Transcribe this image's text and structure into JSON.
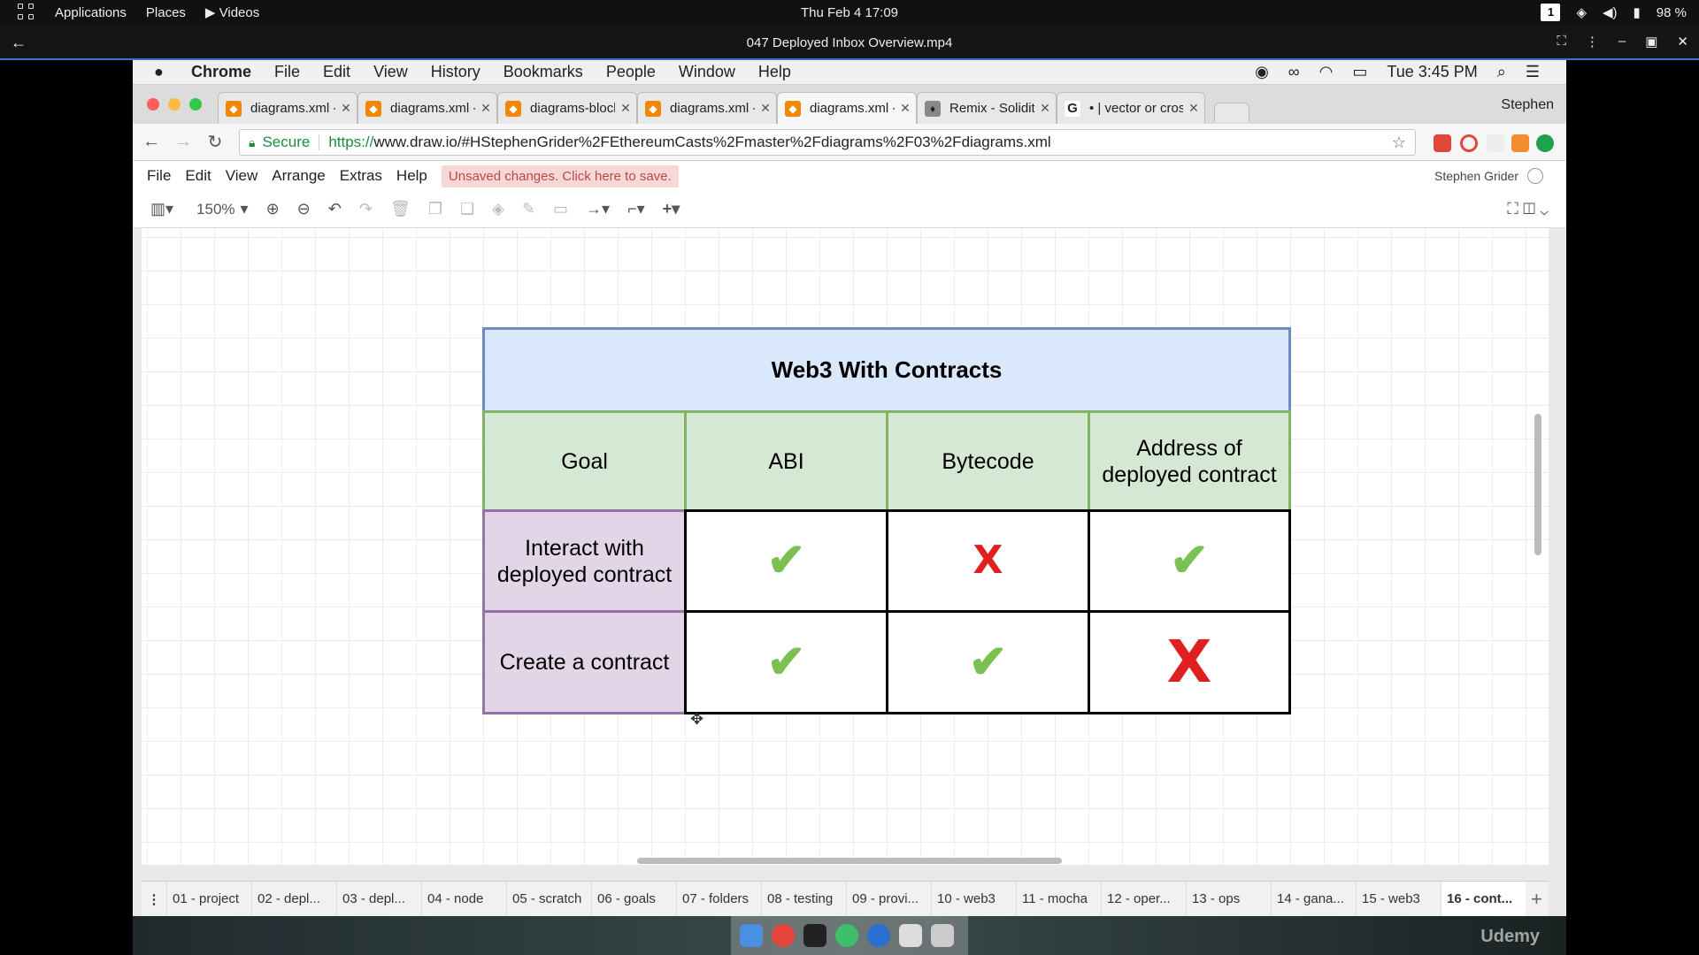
{
  "gnome": {
    "menu_applications": "Applications",
    "menu_places": "Places",
    "menu_videos": "Videos",
    "clock": "Thu Feb 4  17:09",
    "workspace": "1",
    "battery": "98 %"
  },
  "player": {
    "title": "047 Deployed Inbox Overview.mp4"
  },
  "mac": {
    "app": "Chrome",
    "menus": [
      "File",
      "Edit",
      "View",
      "History",
      "Bookmarks",
      "People",
      "Window",
      "Help"
    ],
    "time": "Tue 3:45 PM"
  },
  "chrome": {
    "tabs": [
      {
        "label": "diagrams.xml - dr",
        "color": "#f08705"
      },
      {
        "label": "diagrams.xml - dr",
        "color": "#f08705"
      },
      {
        "label": "diagrams-blockch",
        "color": "#f08705"
      },
      {
        "label": "diagrams.xml - dr",
        "color": "#f08705"
      },
      {
        "label": "diagrams.xml - dr",
        "color": "#f08705"
      },
      {
        "label": "Remix - Solidity ID",
        "color": "#888888"
      },
      {
        "label": "• | vector or cross",
        "color": "#ffffff"
      }
    ],
    "profile": "Stephen",
    "secure_label": "Secure",
    "url_scheme": "https://",
    "url_rest": "www.draw.io/#HStephenGrider%2FEthereumCasts%2Fmaster%2Fdiagrams%2F03%2Fdiagrams.xml"
  },
  "drawio": {
    "menus": [
      "File",
      "Edit",
      "View",
      "Arrange",
      "Extras",
      "Help"
    ],
    "unsaved": "Unsaved changes. Click here to save.",
    "user": "Stephen Grider",
    "zoom": "150%"
  },
  "diagram": {
    "title": "Web3 With Contracts",
    "headers": [
      "Goal",
      "ABI",
      "Bytecode",
      "Address of deployed contract"
    ],
    "rows": [
      {
        "goal": "Interact with deployed contract",
        "abi": "✔",
        "bytecode": "X",
        "address": "✔"
      },
      {
        "goal": "Create a contract",
        "abi": "✔",
        "bytecode": "✔",
        "address": "X"
      }
    ]
  },
  "pages": [
    "01 - project",
    "02 - depl...",
    "03 - depl...",
    "04 - node",
    "05 - scratch",
    "06 - goals",
    "07 - folders",
    "08 - testing",
    "09 - provi...",
    "10 - web3",
    "11 - mocha",
    "12 - oper...",
    "13 - ops",
    "14 - gana...",
    "15 - web3",
    "16 - cont..."
  ],
  "watermark": "Udemy",
  "colors": {
    "title_fill": "#dae8fc",
    "header_fill": "#d5e8d4",
    "goal_fill": "#e1d5e7",
    "check": "#7cbf52",
    "cross": "#e02020",
    "unsaved_bg": "#f8d7d7"
  }
}
